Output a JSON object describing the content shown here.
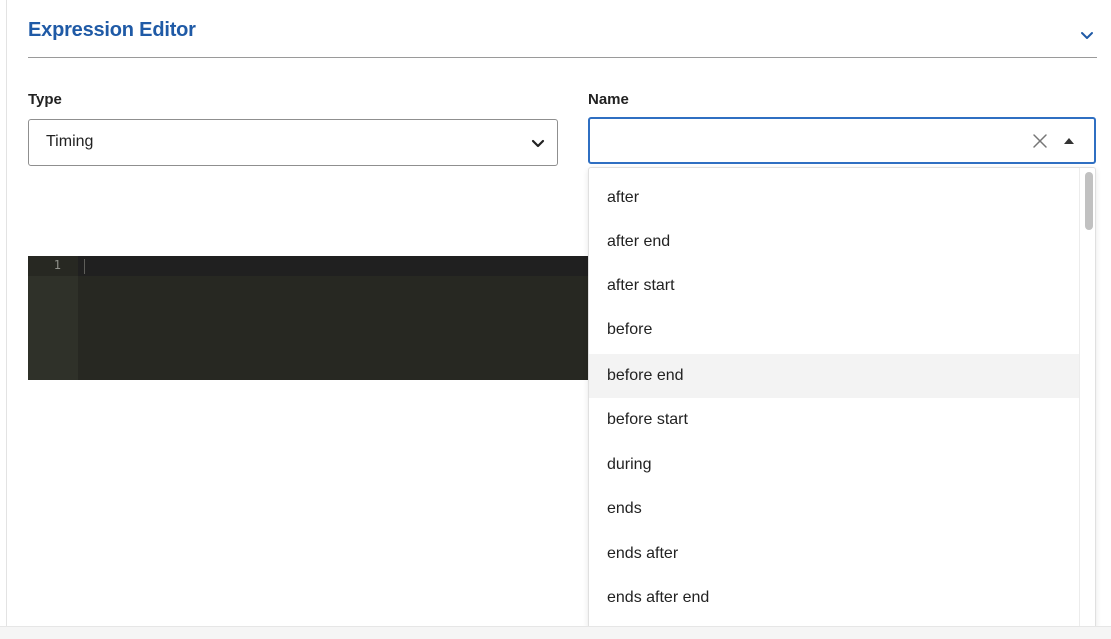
{
  "section": {
    "title": "Expression Editor",
    "chevron_icon": "chevron-down-icon",
    "accent_color": "#1f5aa6"
  },
  "type_field": {
    "label": "Type",
    "value": "Timing",
    "caret_icon": "chevron-down-icon"
  },
  "name_field": {
    "label": "Name",
    "value": "",
    "clear_icon": "close-icon",
    "toggle_icon": "caret-up-icon",
    "focus_color": "#2f6fc2"
  },
  "editor": {
    "line_numbers": [
      "1"
    ],
    "content": ""
  },
  "dropdown": {
    "hovered_index": 4,
    "options": [
      "after",
      "after end",
      "after start",
      "before",
      "before end",
      "before start",
      "during",
      "ends",
      "ends after",
      "ends after end"
    ]
  }
}
